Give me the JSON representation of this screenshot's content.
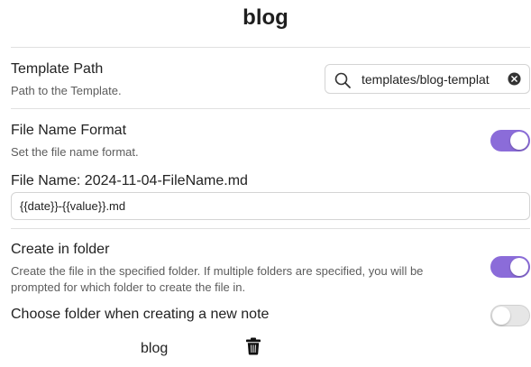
{
  "page": {
    "title": "blog"
  },
  "template_path": {
    "name": "Template Path",
    "description": "Path to the Template.",
    "value": "templates/blog-templat",
    "search_icon": "search-icon",
    "clear_icon": "circle-x-icon"
  },
  "file_name_format": {
    "name": "File Name Format",
    "description": "Set the file name format.",
    "enabled": true,
    "preview_label": "File Name: 2024-11-04-FileName.md",
    "format_value": "{{date}}-{{value}}.md"
  },
  "create_in_folder": {
    "name": "Create in folder",
    "description_line1": "Create the file in the specified folder. If multiple folders are specified, you will be",
    "description_line2": "prompted for which folder to create the file in.",
    "enabled": true
  },
  "choose_folder": {
    "name": "Choose folder when creating a new note",
    "enabled": false
  },
  "folders": [
    {
      "name": "blog",
      "delete_icon": "trash-icon"
    }
  ],
  "colors": {
    "accent": "#8b6cd9",
    "toggle_off": "#e6e6e6",
    "divider": "#e0e0e0"
  }
}
